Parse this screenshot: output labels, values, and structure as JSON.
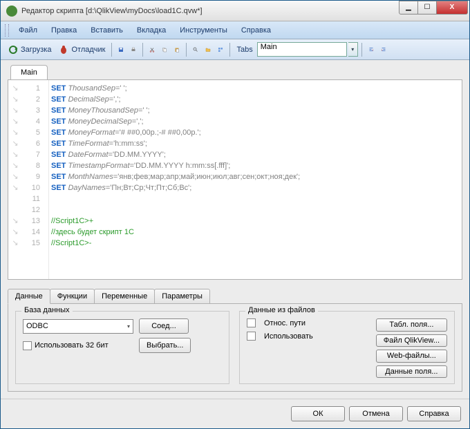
{
  "window": {
    "title": "Редактор скрипта [d:\\QlikView\\myDocs\\load1C.qvw*]"
  },
  "titleControls": {
    "min": "▁",
    "max": "☐",
    "close": "X"
  },
  "menu": {
    "file": "Файл",
    "edit": "Правка",
    "insert": "Вставить",
    "tab": "Вкладка",
    "tools": "Инструменты",
    "help": "Справка"
  },
  "toolbar": {
    "reload": "Загрузка",
    "debug": "Отладчик",
    "tabs_label": "Tabs",
    "tabs_value": "Main",
    "dd": "▾"
  },
  "fileTab": "Main",
  "lines": [
    {
      "n": "1",
      "kw": "SET",
      "var": "ThousandSep",
      "rest": "=' ';"
    },
    {
      "n": "2",
      "kw": "SET",
      "var": "DecimalSep",
      "rest": "=',';"
    },
    {
      "n": "3",
      "kw": "SET",
      "var": "MoneyThousandSep",
      "rest": "=' ';"
    },
    {
      "n": "4",
      "kw": "SET",
      "var": "MoneyDecimalSep",
      "rest": "=',';"
    },
    {
      "n": "5",
      "kw": "SET",
      "var": "MoneyFormat",
      "rest": "='# ##0,00р.;-# ##0,00р.';"
    },
    {
      "n": "6",
      "kw": "SET",
      "var": "TimeFormat",
      "rest": "='h:mm:ss';"
    },
    {
      "n": "7",
      "kw": "SET",
      "var": "DateFormat",
      "rest": "='DD.MM.YYYY';"
    },
    {
      "n": "8",
      "kw": "SET",
      "var": "TimestampFormat",
      "rest": "='DD.MM.YYYY h:mm:ss[.fff]';"
    },
    {
      "n": "9",
      "kw": "SET",
      "var": "MonthNames",
      "rest": "='янв;фев;мар;апр;май;июн;июл;авг;сен;окт;ноя;дек';"
    },
    {
      "n": "10",
      "kw": "SET",
      "var": "DayNames",
      "rest": "='Пн;Вт;Ср;Чт;Пт;Сб;Вс';"
    },
    {
      "n": "11",
      "kw": "",
      "var": "",
      "rest": ""
    },
    {
      "n": "12",
      "kw": "",
      "var": "",
      "rest": ""
    },
    {
      "n": "13",
      "cmt": "//Script1C>+"
    },
    {
      "n": "14",
      "cmt": "//здесь будет скрипт 1С"
    },
    {
      "n": "15",
      "cmt": "//Script1C>-"
    }
  ],
  "panelTabs": {
    "data": "Данные",
    "func": "Функции",
    "vars": "Переменные",
    "params": "Параметры"
  },
  "db": {
    "legend": "База данных",
    "type": "ODBC",
    "use32": "Использовать 32 бит",
    "connect": "Соед...",
    "select": "Выбрать...",
    "dd": "▾"
  },
  "files": {
    "legend": "Данные из файлов",
    "rel": "Относ. пути",
    "use": "Использовать",
    "tablefields": "Табл. поля...",
    "qvfile": "Файл QlikView...",
    "webfiles": "Web-файлы...",
    "datafields": "Данные поля..."
  },
  "dialog": {
    "ok": "ОК",
    "cancel": "Отмена",
    "help": "Справка"
  }
}
